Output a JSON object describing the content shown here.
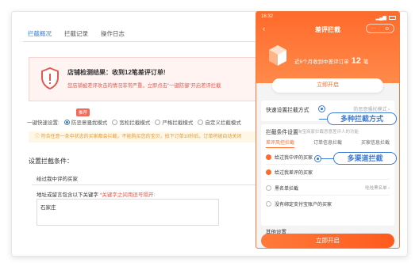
{
  "desktop": {
    "tabs": [
      "拦截概况",
      "拦截记录",
      "操作日志"
    ],
    "alert": {
      "title": "店铺检测结果：收到12笔差评订单!",
      "desc": "您店铺被差评攻击的情况非常严重，立即点击\"一键防御\"开启差评拦截"
    },
    "fast_setting": {
      "label": "一键快速设置:",
      "badge": "推荐",
      "options": [
        "防恶意骚扰模式",
        "宽松拦截模式",
        "严格拦截模式",
        "自定义拦截模式"
      ],
      "selected_index": 0
    },
    "notice": "符合任意一条中状态的买家都会拦截，不能购买您的宝贝，拍下订单10秒后，订单将被自动关闭",
    "conditions": {
      "title": "设置拦截条件：",
      "check1": "给过我中评的买家",
      "keyword_label": "地址或留言包含以下关键字",
      "keyword_hint": "*关键字之间用逗号隔开:",
      "keyword_value": "石家庄"
    }
  },
  "phone": {
    "status": {
      "time": "16:32"
    },
    "title": "差评拦截",
    "capsule": [
      "···",
      "⊙"
    ],
    "stat_prefix": "近6个月收到中差评订单",
    "stat_number": "12",
    "stat_suffix": "笔",
    "start_label": "立即开启",
    "quick_label": "快速设置拦截方式",
    "quick_value": "防恶意骚扰模式 ›",
    "cond_title": "拦截条件设置",
    "cond_sub": "淘宝商家拦截恶意差评人的功能",
    "tabs": [
      "差评风控拦截",
      "订单信息拦截",
      "买家信息拦截"
    ],
    "options": [
      {
        "label": "给过我中评的买家",
        "checked": true,
        "right": ""
      },
      {
        "label": "给过我差评的买家",
        "checked": true,
        "right": ""
      },
      {
        "label": "黑名单拦截",
        "checked": false,
        "right": "哇哇黑名单 ›"
      },
      {
        "label": "没有绑定支付宝账户的买家",
        "checked": false,
        "right": ""
      }
    ],
    "other_label": "其他设置",
    "bottom_button": "立即开启"
  },
  "callouts": {
    "first": "多种拦截方式",
    "second": "多渠道拦截"
  },
  "colors": {
    "accent_orange": "#ff6a2b",
    "accent_blue": "#3b7bd4",
    "alert_red": "#e15a4e"
  }
}
